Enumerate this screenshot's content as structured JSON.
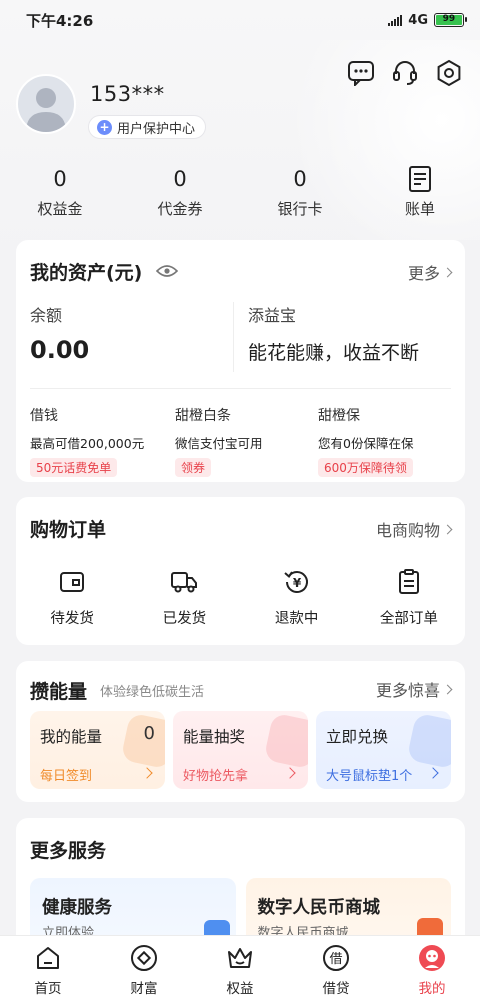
{
  "status_bar": {
    "time": "下午4:26",
    "network": "4G",
    "battery": "99"
  },
  "header": {
    "icons": [
      "message-icon",
      "customer-service-icon",
      "settings-icon"
    ]
  },
  "profile": {
    "phone": "153***",
    "protect_label": "用户保护中心"
  },
  "summary": {
    "items": [
      {
        "value": "0",
        "label": "权益金"
      },
      {
        "value": "0",
        "label": "代金券"
      },
      {
        "value": "0",
        "label": "银行卡"
      },
      {
        "label": "账单"
      }
    ]
  },
  "assets": {
    "title": "我的资产(元)",
    "more": "更多",
    "balance_label": "余额",
    "balance_value": "0.00",
    "tianyibao_label": "添益宝",
    "tianyibao_desc": "能花能赚，收益不断",
    "loans": [
      {
        "title": "借钱",
        "desc": "最高可借200,000元",
        "tag": "50元话费免单"
      },
      {
        "title": "甜橙白条",
        "desc": "微信支付宝可用",
        "tag": "领券"
      },
      {
        "title": "甜橙保",
        "desc": "您有0份保障在保",
        "tag": "600万保障待领"
      }
    ]
  },
  "orders": {
    "title": "购物订单",
    "more": "电商购物",
    "items": [
      {
        "label": "待发货",
        "icon": "wallet-icon"
      },
      {
        "label": "已发货",
        "icon": "truck-icon"
      },
      {
        "label": "退款中",
        "icon": "refund-icon"
      },
      {
        "label": "全部订单",
        "icon": "order-list-icon"
      }
    ]
  },
  "energy": {
    "title": "攒能量",
    "subtitle": "体验绿色低碳生活",
    "more": "更多惊喜",
    "cards": [
      {
        "title": "我的能量",
        "value": "0",
        "sub": "每日签到",
        "color": "#f08c2c"
      },
      {
        "title": "能量抽奖",
        "sub": "好物抢先拿",
        "color": "#ec5a62"
      },
      {
        "title": "立即兑换",
        "sub": "大号鼠标垫1个",
        "color": "#3e6fe0"
      }
    ]
  },
  "services": {
    "title": "更多服务",
    "items": [
      {
        "title": "健康服务",
        "sub": "立即体验"
      },
      {
        "title": "数字人民币商城",
        "sub": "数字人民币商城"
      }
    ]
  },
  "bottom_nav": {
    "items": [
      {
        "label": "首页",
        "icon": "home-icon"
      },
      {
        "label": "财富",
        "icon": "wealth-icon"
      },
      {
        "label": "权益",
        "icon": "crown-icon"
      },
      {
        "label": "借贷",
        "icon": "loan-icon"
      },
      {
        "label": "我的",
        "icon": "profile-icon",
        "active": true
      }
    ]
  },
  "colors": {
    "accent_red": "#e9414b",
    "tag_bg": "#fde9ea",
    "battery_green": "#37c24f"
  }
}
